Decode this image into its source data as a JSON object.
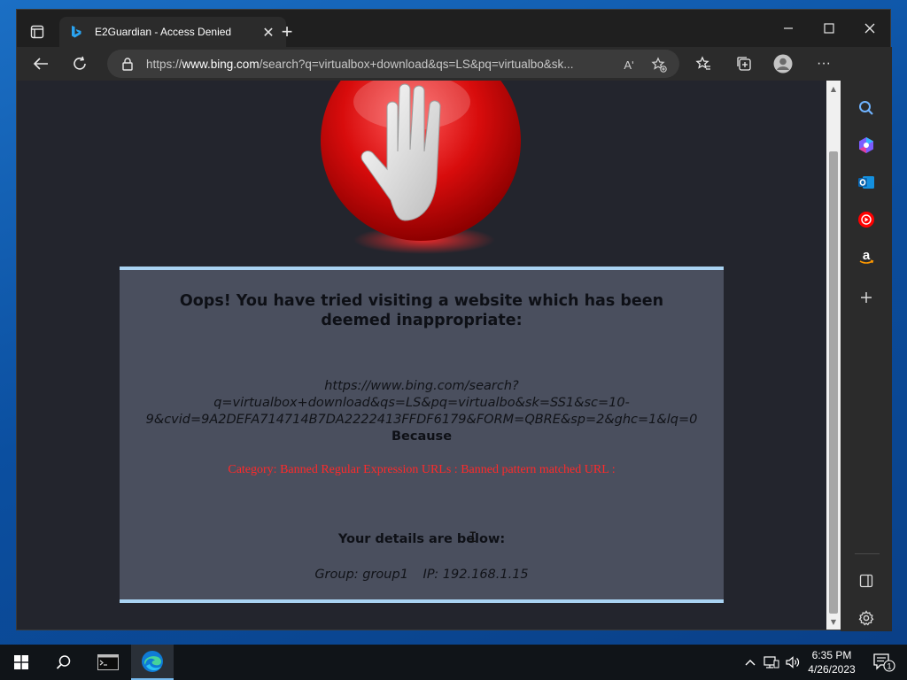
{
  "browser": {
    "tab": {
      "title": "E2Guardian - Access Denied"
    },
    "address": {
      "scheme": "https://",
      "host": "www.bing.com",
      "path": "/search?q=virtualbox+download&qs=LS&pq=virtualbo&sk..."
    },
    "read_aloud_label": "Aʹ"
  },
  "page": {
    "heading": "Oops! You have tried visiting a website which has been deemed inappropriate:",
    "blocked_url": "https://www.bing.com/search?q=virtualbox+download&qs=LS&pq=virtualbo&sk=SS1&sc=10-9&cvid=9A2DEFA714714B7DA2222413FFDF6179&FORM=QBRE&sp=2&ghc=1&lq=0",
    "because_label": "Because",
    "category_text": "Category: Banned Regular Expression URLs : Banned pattern matched URL :",
    "details_title": "Your details are below:",
    "group_text": "Group: group1",
    "ip_text": "IP: 192.168.1.15"
  },
  "taskbar": {
    "time": "6:35 PM",
    "date": "4/26/2023",
    "notification_count": "1"
  },
  "colors": {
    "panel_bg": "#4a4f5e",
    "panel_border": "#a9d3f2",
    "category_red": "#ff2a2a",
    "page_bg": "#23252d"
  },
  "icons": {
    "stop_sign": "stop-hand-icon",
    "sidebar": [
      "search-icon",
      "copilot-icon",
      "outlook-icon",
      "youtube-music-icon",
      "amazon-icon",
      "add-icon",
      "split-screen-icon",
      "settings-icon"
    ]
  }
}
